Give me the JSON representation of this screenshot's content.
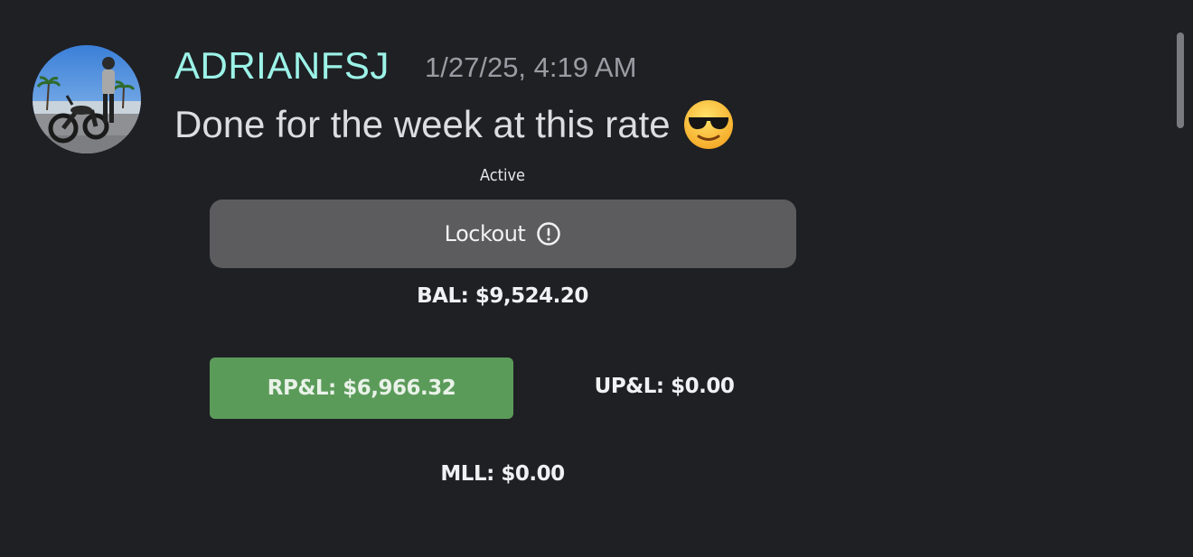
{
  "message": {
    "username": "ADRIANFSJ",
    "timestamp": "1/27/25, 4:19 AM",
    "text": "Done for the week at this rate",
    "emoji": "smiling-face-with-sunglasses-icon"
  },
  "embed": {
    "status": "Active",
    "lockout_label": "Lockout",
    "lockout_icon": "alert-circle-icon",
    "balance": "BAL: $9,524.20",
    "realized_pnl": "RP&L: $6,966.32",
    "unrealized_pnl": "UP&L: $0.00",
    "mll": "MLL: $0.00"
  },
  "colors": {
    "background": "#1f2024",
    "username": "#9cf3e8",
    "lockout_button": "#5c5c5e",
    "rpl_button": "#5b9b5a"
  }
}
